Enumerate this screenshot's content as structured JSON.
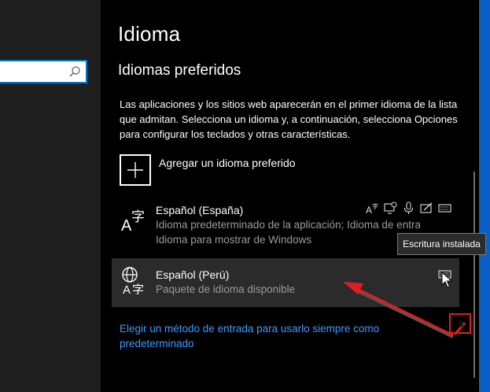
{
  "window": {
    "page_title": "Idioma",
    "section_title": "Idiomas preferidos",
    "description": "Las aplicaciones y los sitios web aparecerán en el primer idioma de la lista que admitan. Selecciona un idioma y, a continuación, selecciona Opciones para configurar los teclados y otras características."
  },
  "search": {
    "value": "",
    "placeholder": "",
    "icon": "search-icon"
  },
  "add_language": {
    "label": "Agregar un idioma preferido",
    "icon": "plus-icon"
  },
  "languages": [
    {
      "name": "Español (España)",
      "line1": "Idioma predeterminado de la aplicación; Idioma de entrad...",
      "line2": "Idioma para mostrar de Windows",
      "icon": "language-icon",
      "features": [
        "text-to-speech-icon",
        "display-language-icon",
        "speech-recognition-icon",
        "handwriting-icon",
        "keyboard-icon"
      ]
    },
    {
      "name": "Español (Perú)",
      "line1": "Paquete de idioma disponible",
      "icon": "language-pack-icon",
      "features": [
        "keyboard-icon"
      ]
    }
  ],
  "tooltip": {
    "text": "Escritura instalada"
  },
  "link": {
    "text": "Elegir un método de entrada para usarlo siempre como predeterminado"
  },
  "colors": {
    "accent": "#0078d7",
    "link": "#3d9bff",
    "annotation": "#e01e1e",
    "selected_bg": "#2b2b2b"
  }
}
